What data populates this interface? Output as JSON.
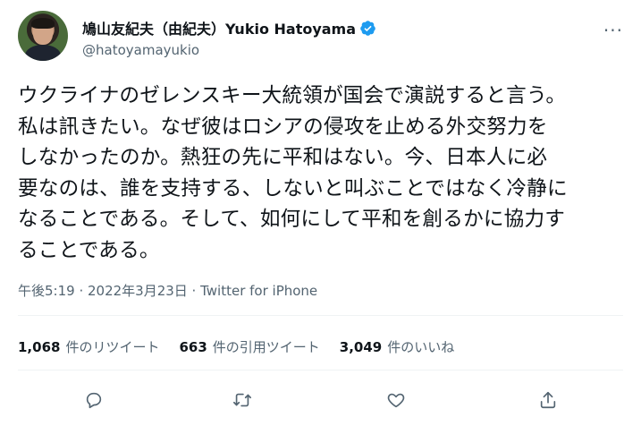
{
  "author": {
    "display_name": "鳩山友紀夫（由紀夫）Yukio Hatoyama",
    "handle": "@hatoyamayukio",
    "verified": true
  },
  "tweet": {
    "text": "ウクライナのゼレンスキー大統領が国会で演説すると言う。\n私は訊きたい。なぜ彼はロシアの侵攻を止める外交努力を\nしなかったのか。熱狂の先に平和はない。今、日本人に必\n要なのは、誰を支持する、しないと叫ぶことではなく冷静に\nなることである。そして、如何にして平和を創るかに協力す\nることである。",
    "timestamp": "午後5:19 · 2022年3月23日 · Twitter for iPhone"
  },
  "stats": {
    "retweets_count": "1,068",
    "retweets_label": "件のリツイート",
    "quotes_count": "663",
    "quotes_label": "件の引用ツイート",
    "likes_count": "3,049",
    "likes_label": "件のいいね"
  },
  "colors": {
    "verified_blue": "#1d9bf0",
    "text": "#0f1419",
    "secondary": "#536471",
    "divider": "#eff3f4"
  }
}
